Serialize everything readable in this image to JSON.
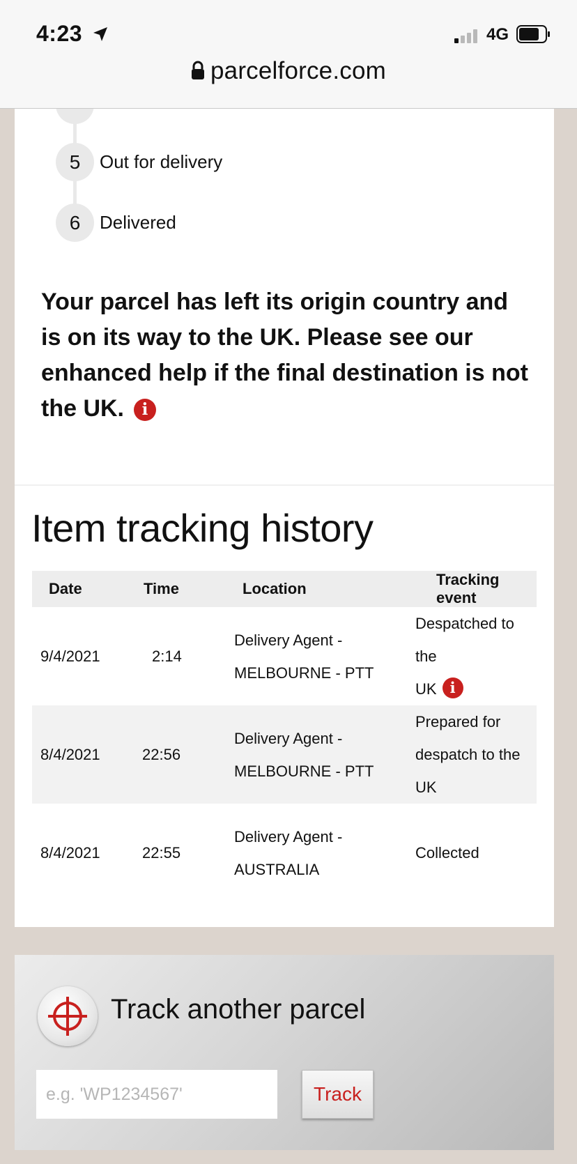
{
  "status_bar": {
    "time": "4:23",
    "network": "4G",
    "url": "parcelforce.com"
  },
  "steps": [
    {
      "number": "5",
      "label": "Out for delivery"
    },
    {
      "number": "6",
      "label": "Delivered"
    }
  ],
  "notice": {
    "text": "Your parcel has left its origin country and is on its way to the UK. Please see our enhanced help if the final destination is not the UK.",
    "info_icon": "i"
  },
  "history": {
    "title": "Item tracking history",
    "columns": [
      "Date",
      "Time",
      "Location",
      "Tracking event"
    ],
    "rows": [
      {
        "date": "9/4/2021",
        "time": "2:14",
        "location_line1": "Delivery Agent -",
        "location_line2": "MELBOURNE - PTT",
        "event_line1": "Despatched to the",
        "event_line2": "UK",
        "info_icon": "i"
      },
      {
        "date": "8/4/2021",
        "time": "22:56",
        "location_line1": "Delivery Agent -",
        "location_line2": "MELBOURNE - PTT",
        "event_line1": "Prepared for",
        "event_line2": "despatch to the UK"
      },
      {
        "date": "8/4/2021",
        "time": "22:55",
        "location_line1": "Delivery Agent -",
        "location_line2": "AUSTRALIA",
        "event_line1": "Collected",
        "event_line2": ""
      }
    ]
  },
  "track_another": {
    "title": "Track another parcel",
    "placeholder": "e.g. 'WP1234567'",
    "button_label": "Track"
  },
  "colors": {
    "brand_red": "#c8201e",
    "page_bg": "#dcd4cd"
  }
}
